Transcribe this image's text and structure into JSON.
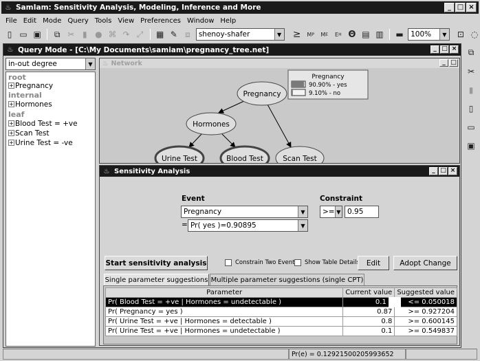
{
  "app": {
    "title": "SamIam: Sensitivity Analysis, Modeling, Inference and More"
  },
  "menu": [
    "File",
    "Edit",
    "Mode",
    "Query",
    "Tools",
    "View",
    "Preferences",
    "Window",
    "Help"
  ],
  "toolbar": {
    "algorithm": "shenoy-shafer",
    "zoom": "100%",
    "ge_symbol": "≥",
    "mb_label": "M",
    "mb_sub": "P",
    "mp_label": "M",
    "mp_sub": "E",
    "eh_label": "E",
    "eh_sub": "H",
    "theta_symbol": "Θ"
  },
  "query_window": {
    "title": "Query Mode - [C:\\My Documents\\samiam\\pregnancy_tree.net]",
    "sort_combo": "in-out degree",
    "tree": {
      "root_label": "root",
      "root_items": [
        "Pregnancy"
      ],
      "internal_label": "internal",
      "internal_items": [
        "Hormones"
      ],
      "leaf_label": "leaf",
      "leaf_items": [
        "Blood Test = +ve",
        "Scan Test",
        "Urine Test = -ve"
      ]
    }
  },
  "network": {
    "title": "Network",
    "nodes": {
      "pregnancy": "Pregnancy",
      "hormones": "Hormones",
      "urine": "Urine Test",
      "blood": "Blood Test",
      "scan": "Scan Test"
    },
    "monitor": {
      "title": "Pregnancy",
      "rows": [
        {
          "text": "90.90% - yes",
          "fraction": 0.909
        },
        {
          "text": "9.10% - no",
          "fraction": 0.091
        }
      ]
    }
  },
  "sensitivity": {
    "title": "Sensitivity Analysis",
    "event_label": "Event",
    "event_value": "Pregnancy",
    "eq_sign": "=",
    "event_prob": "Pr( yes )=0.90895",
    "constraint_label": "Constraint",
    "constraint_op": ">=",
    "constraint_value": "0.95",
    "start_button": "Start sensitivity analysis",
    "constrain_two": "Constrain Two Events",
    "show_table": "Show Table Details",
    "edit_button": "Edit",
    "adopt_button": "Adopt Change",
    "tabs": [
      "Single parameter suggestions",
      "Multiple parameter suggestions (single CPT)"
    ],
    "columns": [
      "Parameter",
      "Current value",
      "Suggested value"
    ],
    "rows": [
      {
        "param": "Pr( Blood Test = +ve | Hormones = undetectable )",
        "current": "0.1",
        "suggested": "<= 0.050018"
      },
      {
        "param": "Pr( Pregnancy = yes )",
        "current": "0.87",
        "suggested": ">= 0.927204"
      },
      {
        "param": "Pr( Urine Test = +ve | Hormones = detectable )",
        "current": "0.8",
        "suggested": ">= 0.600145"
      },
      {
        "param": "Pr( Urine Test = +ve | Hormones = undetectable )",
        "current": "0.1",
        "suggested": ">= 0.549837"
      }
    ]
  },
  "status": {
    "pr_e": "Pr(e) = 0.12921500205993652"
  },
  "colors": {
    "titlebar": "#1a1a1a",
    "node_fill": "#dedede",
    "selected_row": "#000000"
  }
}
